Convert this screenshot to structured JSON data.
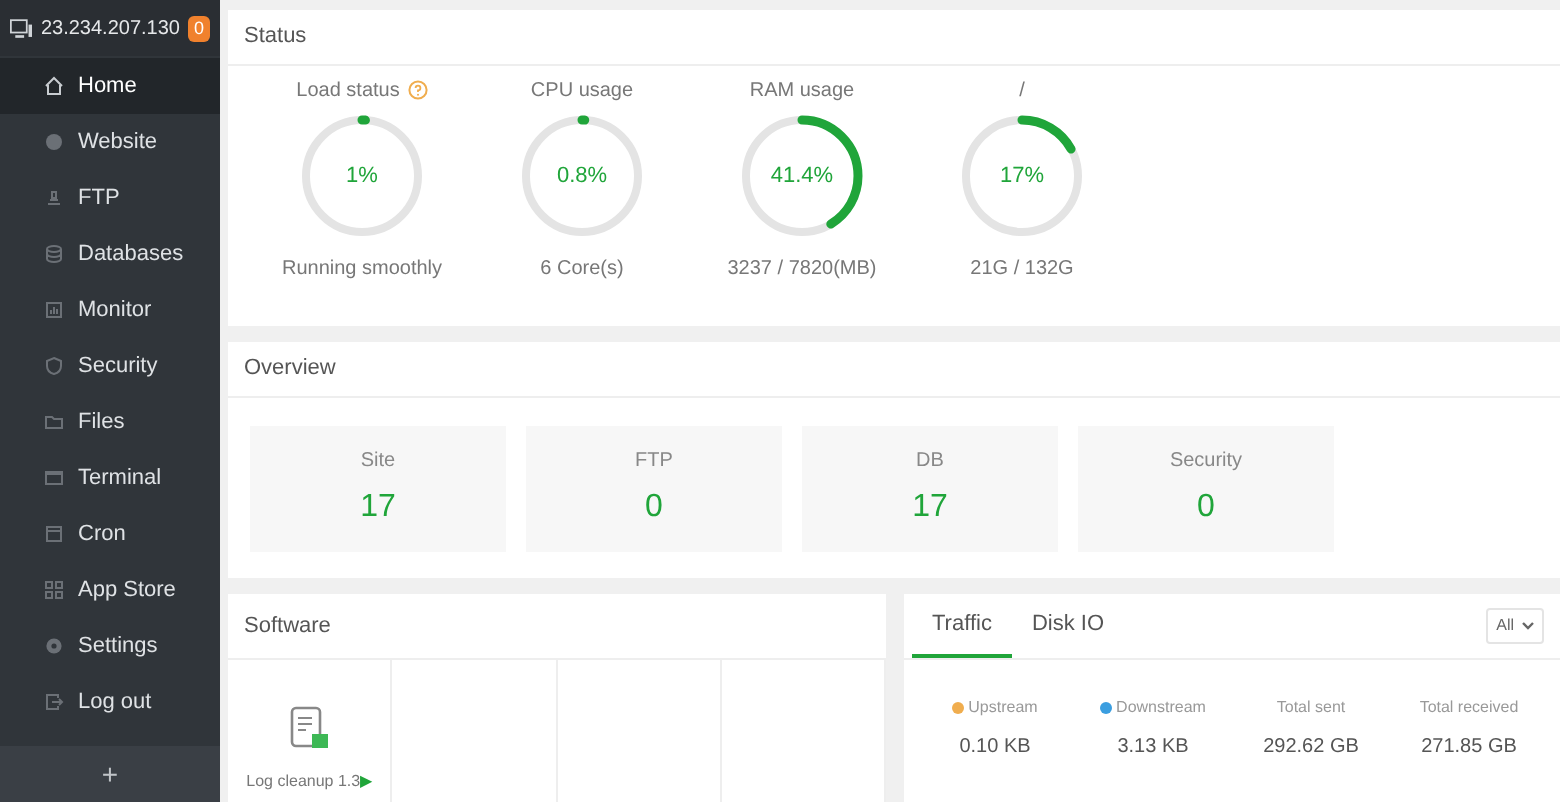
{
  "sidebar": {
    "server": {
      "address": "23.234.207.130",
      "badge": "0"
    },
    "items": [
      {
        "label": "Home",
        "selected": true
      },
      {
        "label": "Website",
        "selected": false
      },
      {
        "label": "FTP",
        "selected": false
      },
      {
        "label": "Databases",
        "selected": false
      },
      {
        "label": "Monitor",
        "selected": false
      },
      {
        "label": "Security",
        "selected": false
      },
      {
        "label": "Files",
        "selected": false
      },
      {
        "label": "Terminal",
        "selected": false
      },
      {
        "label": "Cron",
        "selected": false
      },
      {
        "label": "App Store",
        "selected": false
      },
      {
        "label": "Settings",
        "selected": false
      },
      {
        "label": "Log out",
        "selected": false
      }
    ],
    "add_button": "+"
  },
  "status": {
    "title": "Status",
    "gauges": [
      {
        "label": "Load status",
        "help": true,
        "value": "1%",
        "detail": "Running smoothly"
      },
      {
        "label": "CPU usage",
        "value": "0.8%",
        "detail": "6 Core(s)"
      },
      {
        "label": "RAM usage",
        "value": "41.4%",
        "detail": "3237 / 7820(MB)"
      },
      {
        "label": "/",
        "value": "17%",
        "detail": "21G / 132G"
      }
    ]
  },
  "overview": {
    "title": "Overview",
    "tiles": [
      {
        "label": "Site",
        "value": "17"
      },
      {
        "label": "FTP",
        "value": "0"
      },
      {
        "label": "DB",
        "value": "17"
      },
      {
        "label": "Security",
        "value": "0"
      }
    ]
  },
  "software": {
    "title": "Software",
    "items": [
      {
        "label": "Log cleanup 1.3",
        "play": "▶"
      }
    ]
  },
  "traffic": {
    "tabs": [
      {
        "label": "Traffic",
        "selected": true
      },
      {
        "label": "Disk IO",
        "selected": false
      }
    ],
    "filter": "All",
    "stats": [
      {
        "label": "Upstream",
        "value": "0.10 KB",
        "color": "#f0ad4e"
      },
      {
        "label": "Downstream",
        "value": "3.13 KB",
        "color": "#3b9ee0"
      },
      {
        "label": "Total sent",
        "value": "292.62 GB"
      },
      {
        "label": "Total received",
        "value": "271.85 GB"
      }
    ]
  }
}
